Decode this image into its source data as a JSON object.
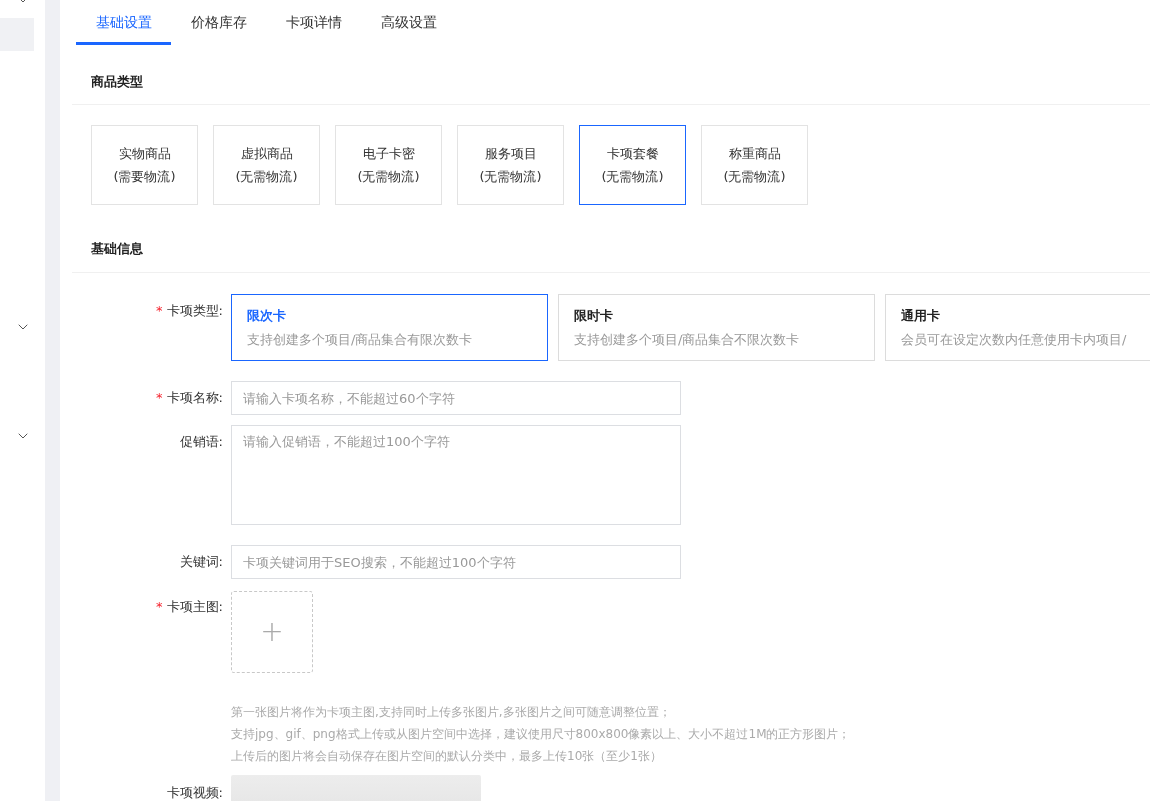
{
  "sidebar": {
    "items": [
      {
        "kind": "group"
      },
      {
        "kind": "item",
        "selected": true
      },
      {
        "kind": "group"
      },
      {
        "kind": "group"
      }
    ]
  },
  "tabs": [
    {
      "label": "基础设置",
      "selected": true
    },
    {
      "label": "价格库存",
      "selected": false
    },
    {
      "label": "卡项详情",
      "selected": false
    },
    {
      "label": "高级设置",
      "selected": false
    }
  ],
  "product_type": {
    "title": "商品类型",
    "options": [
      {
        "name": "实物商品",
        "note": "(需要物流)",
        "selected": false
      },
      {
        "name": "虚拟商品",
        "note": "(无需物流)",
        "selected": false
      },
      {
        "name": "电子卡密",
        "note": "(无需物流)",
        "selected": false
      },
      {
        "name": "服务项目",
        "note": "(无需物流)",
        "selected": false
      },
      {
        "name": "卡项套餐",
        "note": "(无需物流)",
        "selected": true
      },
      {
        "name": "称重商品",
        "note": "(无需物流)",
        "selected": false
      }
    ]
  },
  "basic_info": {
    "title": "基础信息",
    "card_type": {
      "label": "卡项类型:",
      "mark": "*",
      "options": [
        {
          "name": "限次卡",
          "desc": "支持创建多个项目/商品集合有限次数卡",
          "selected": true
        },
        {
          "name": "限时卡",
          "desc": "支持创建多个项目/商品集合不限次数卡",
          "selected": false
        },
        {
          "name": "通用卡",
          "desc": "会员可在设定次数内任意使用卡内项目/",
          "selected": false
        }
      ]
    },
    "fields": [
      {
        "kind": "input",
        "label": "卡项名称:",
        "mark": "*",
        "placeholder": "请输入卡项名称，不能超过60个字符"
      },
      {
        "kind": "textarea",
        "label": "促销语:",
        "placeholder": "请输入促销语，不能超过100个字符"
      },
      {
        "kind": "input",
        "label": "关键词:",
        "placeholder": "卡项关键词用于SEO搜索，不能超过100个字符"
      },
      {
        "kind": "upload",
        "label": "卡项主图:",
        "mark": "*",
        "button": "+",
        "hints": [
          "第一张图片将作为卡项主图,支持同时上传多张图片,多张图片之间可随意调整位置；",
          "支持jpg、gif、png格式上传或从图片空间中选择，建议使用尺寸800x800像素以上、大小不超过1M的正方形图片；",
          "上传后的图片将会自动保存在图片空间的默认分类中，最多上传10张（至少1张）"
        ]
      },
      {
        "kind": "video",
        "label": "卡项视频:"
      }
    ]
  }
}
